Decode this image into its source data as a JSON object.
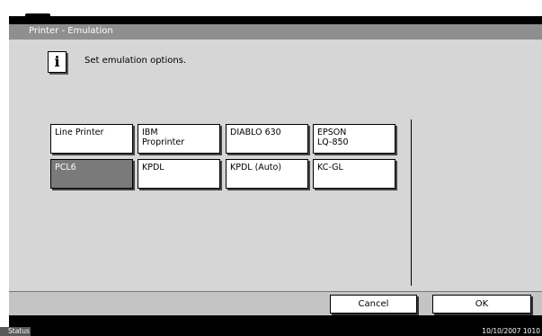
{
  "window": {
    "title": "Printer - Emulation"
  },
  "info": {
    "icon": "info-icon",
    "icon_glyph": "i",
    "message": "Set emulation options."
  },
  "emulations": [
    {
      "label": "Line Printer",
      "selected": false
    },
    {
      "label": "IBM\nProprinter",
      "selected": false
    },
    {
      "label": "DIABLO 630",
      "selected": false
    },
    {
      "label": "EPSON\nLQ-850",
      "selected": false
    },
    {
      "label": "PCL6",
      "selected": true
    },
    {
      "label": "KPDL",
      "selected": false
    },
    {
      "label": "KPDL (Auto)",
      "selected": false
    },
    {
      "label": "KC-GL",
      "selected": false
    }
  ],
  "footer": {
    "cancel_label": "Cancel",
    "ok_label": "OK"
  },
  "status": {
    "label": "Status",
    "datetime": "10/10/2007   1010"
  }
}
